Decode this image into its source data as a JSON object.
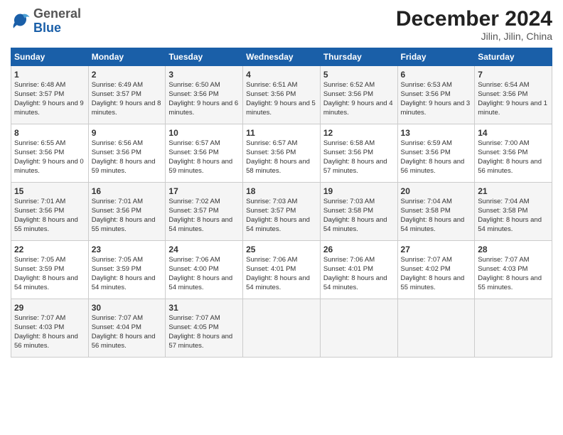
{
  "header": {
    "logo_general": "General",
    "logo_blue": "Blue",
    "month_title": "December 2024",
    "location": "Jilin, Jilin, China"
  },
  "days_of_week": [
    "Sunday",
    "Monday",
    "Tuesday",
    "Wednesday",
    "Thursday",
    "Friday",
    "Saturday"
  ],
  "weeks": [
    [
      {
        "day": "1",
        "info": "Sunrise: 6:48 AM\nSunset: 3:57 PM\nDaylight: 9 hours and 9 minutes."
      },
      {
        "day": "2",
        "info": "Sunrise: 6:49 AM\nSunset: 3:57 PM\nDaylight: 9 hours and 8 minutes."
      },
      {
        "day": "3",
        "info": "Sunrise: 6:50 AM\nSunset: 3:56 PM\nDaylight: 9 hours and 6 minutes."
      },
      {
        "day": "4",
        "info": "Sunrise: 6:51 AM\nSunset: 3:56 PM\nDaylight: 9 hours and 5 minutes."
      },
      {
        "day": "5",
        "info": "Sunrise: 6:52 AM\nSunset: 3:56 PM\nDaylight: 9 hours and 4 minutes."
      },
      {
        "day": "6",
        "info": "Sunrise: 6:53 AM\nSunset: 3:56 PM\nDaylight: 9 hours and 3 minutes."
      },
      {
        "day": "7",
        "info": "Sunrise: 6:54 AM\nSunset: 3:56 PM\nDaylight: 9 hours and 1 minute."
      }
    ],
    [
      {
        "day": "8",
        "info": "Sunrise: 6:55 AM\nSunset: 3:56 PM\nDaylight: 9 hours and 0 minutes."
      },
      {
        "day": "9",
        "info": "Sunrise: 6:56 AM\nSunset: 3:56 PM\nDaylight: 8 hours and 59 minutes."
      },
      {
        "day": "10",
        "info": "Sunrise: 6:57 AM\nSunset: 3:56 PM\nDaylight: 8 hours and 59 minutes."
      },
      {
        "day": "11",
        "info": "Sunrise: 6:57 AM\nSunset: 3:56 PM\nDaylight: 8 hours and 58 minutes."
      },
      {
        "day": "12",
        "info": "Sunrise: 6:58 AM\nSunset: 3:56 PM\nDaylight: 8 hours and 57 minutes."
      },
      {
        "day": "13",
        "info": "Sunrise: 6:59 AM\nSunset: 3:56 PM\nDaylight: 8 hours and 56 minutes."
      },
      {
        "day": "14",
        "info": "Sunrise: 7:00 AM\nSunset: 3:56 PM\nDaylight: 8 hours and 56 minutes."
      }
    ],
    [
      {
        "day": "15",
        "info": "Sunrise: 7:01 AM\nSunset: 3:56 PM\nDaylight: 8 hours and 55 minutes."
      },
      {
        "day": "16",
        "info": "Sunrise: 7:01 AM\nSunset: 3:56 PM\nDaylight: 8 hours and 55 minutes."
      },
      {
        "day": "17",
        "info": "Sunrise: 7:02 AM\nSunset: 3:57 PM\nDaylight: 8 hours and 54 minutes."
      },
      {
        "day": "18",
        "info": "Sunrise: 7:03 AM\nSunset: 3:57 PM\nDaylight: 8 hours and 54 minutes."
      },
      {
        "day": "19",
        "info": "Sunrise: 7:03 AM\nSunset: 3:58 PM\nDaylight: 8 hours and 54 minutes."
      },
      {
        "day": "20",
        "info": "Sunrise: 7:04 AM\nSunset: 3:58 PM\nDaylight: 8 hours and 54 minutes."
      },
      {
        "day": "21",
        "info": "Sunrise: 7:04 AM\nSunset: 3:58 PM\nDaylight: 8 hours and 54 minutes."
      }
    ],
    [
      {
        "day": "22",
        "info": "Sunrise: 7:05 AM\nSunset: 3:59 PM\nDaylight: 8 hours and 54 minutes."
      },
      {
        "day": "23",
        "info": "Sunrise: 7:05 AM\nSunset: 3:59 PM\nDaylight: 8 hours and 54 minutes."
      },
      {
        "day": "24",
        "info": "Sunrise: 7:06 AM\nSunset: 4:00 PM\nDaylight: 8 hours and 54 minutes."
      },
      {
        "day": "25",
        "info": "Sunrise: 7:06 AM\nSunset: 4:01 PM\nDaylight: 8 hours and 54 minutes."
      },
      {
        "day": "26",
        "info": "Sunrise: 7:06 AM\nSunset: 4:01 PM\nDaylight: 8 hours and 54 minutes."
      },
      {
        "day": "27",
        "info": "Sunrise: 7:07 AM\nSunset: 4:02 PM\nDaylight: 8 hours and 55 minutes."
      },
      {
        "day": "28",
        "info": "Sunrise: 7:07 AM\nSunset: 4:03 PM\nDaylight: 8 hours and 55 minutes."
      }
    ],
    [
      {
        "day": "29",
        "info": "Sunrise: 7:07 AM\nSunset: 4:03 PM\nDaylight: 8 hours and 56 minutes."
      },
      {
        "day": "30",
        "info": "Sunrise: 7:07 AM\nSunset: 4:04 PM\nDaylight: 8 hours and 56 minutes."
      },
      {
        "day": "31",
        "info": "Sunrise: 7:07 AM\nSunset: 4:05 PM\nDaylight: 8 hours and 57 minutes."
      },
      {
        "day": "",
        "info": ""
      },
      {
        "day": "",
        "info": ""
      },
      {
        "day": "",
        "info": ""
      },
      {
        "day": "",
        "info": ""
      }
    ]
  ]
}
